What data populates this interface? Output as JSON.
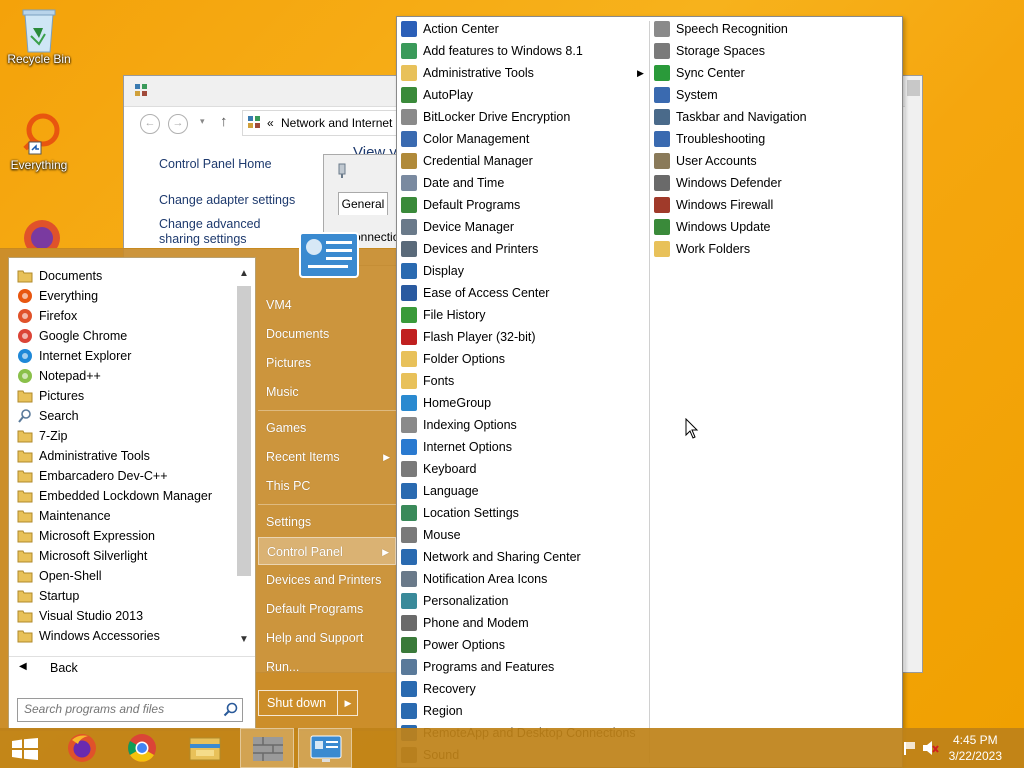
{
  "desktop": {
    "icons": [
      {
        "label": "Recycle Bin",
        "icon": "recycle-bin-icon"
      },
      {
        "label": "Everything",
        "icon": "everything-search-icon"
      }
    ]
  },
  "background_window": {
    "address_prefix": "«",
    "address_path": "Network and Internet",
    "sidebar_links": [
      "Control Panel Home",
      "Change adapter settings",
      "Change advanced sharing settings"
    ],
    "view_label": "View y",
    "dialog_tab": "General",
    "dialog_partial_text": "onnectio"
  },
  "start_menu": {
    "programs": [
      {
        "label": "Documents",
        "icon": "folder-icon"
      },
      {
        "label": "Everything",
        "icon": "everything-search-icon"
      },
      {
        "label": "Firefox",
        "icon": "firefox-icon"
      },
      {
        "label": "Google Chrome",
        "icon": "chrome-icon"
      },
      {
        "label": "Internet Explorer",
        "icon": "internet-explorer-icon"
      },
      {
        "label": "Notepad++",
        "icon": "notepad-plus-icon"
      },
      {
        "label": "Pictures",
        "icon": "folder-icon"
      },
      {
        "label": "Search",
        "icon": "search-icon"
      },
      {
        "label": "7-Zip",
        "icon": "folder-icon"
      },
      {
        "label": "Administrative Tools",
        "icon": "folder-icon"
      },
      {
        "label": "Embarcadero Dev-C++",
        "icon": "folder-icon"
      },
      {
        "label": "Embedded Lockdown Manager",
        "icon": "folder-icon"
      },
      {
        "label": "Maintenance",
        "icon": "folder-icon"
      },
      {
        "label": "Microsoft Expression",
        "icon": "folder-icon"
      },
      {
        "label": "Microsoft Silverlight",
        "icon": "folder-icon"
      },
      {
        "label": "Open-Shell",
        "icon": "folder-icon"
      },
      {
        "label": "Startup",
        "icon": "folder-icon"
      },
      {
        "label": "Visual Studio 2013",
        "icon": "folder-icon"
      },
      {
        "label": "Windows Accessories",
        "icon": "folder-icon"
      }
    ],
    "back_label": "Back",
    "search_placeholder": "Search programs and files",
    "right_items": {
      "user": "VM4",
      "documents": "Documents",
      "pictures": "Pictures",
      "music": "Music",
      "games": "Games",
      "recent_items": "Recent Items",
      "this_pc": "This PC",
      "settings": "Settings",
      "control_panel": "Control Panel",
      "devices_printers": "Devices and Printers",
      "default_programs": "Default Programs",
      "help_support": "Help and Support",
      "run": "Run..."
    },
    "shutdown_label": "Shut down"
  },
  "control_panel_menu": {
    "column1": [
      {
        "label": "Action Center",
        "color": "#2b5fb8"
      },
      {
        "label": "Add features to Windows 8.1",
        "color": "#3a9a5a"
      },
      {
        "label": "Administrative Tools",
        "color": "#e8c15a",
        "submenu": true
      },
      {
        "label": "AutoPlay",
        "color": "#3a8a3a"
      },
      {
        "label": "BitLocker Drive Encryption",
        "color": "#8a8a8a"
      },
      {
        "label": "Color Management",
        "color": "#3a6ab0"
      },
      {
        "label": "Credential Manager",
        "color": "#b08a3a"
      },
      {
        "label": "Date and Time",
        "color": "#7a8aa0"
      },
      {
        "label": "Default Programs",
        "color": "#3a8a3a"
      },
      {
        "label": "Device Manager",
        "color": "#6a7a8a"
      },
      {
        "label": "Devices and Printers",
        "color": "#5a6a7a"
      },
      {
        "label": "Display",
        "color": "#2a6ab0"
      },
      {
        "label": "Ease of Access Center",
        "color": "#2a5aa0"
      },
      {
        "label": "File History",
        "color": "#3a9a3a"
      },
      {
        "label": "Flash Player (32-bit)",
        "color": "#c02020"
      },
      {
        "label": "Folder Options",
        "color": "#e8c15a"
      },
      {
        "label": "Fonts",
        "color": "#e8c15a"
      },
      {
        "label": "HomeGroup",
        "color": "#2a8ad0"
      },
      {
        "label": "Indexing Options",
        "color": "#8a8a8a"
      },
      {
        "label": "Internet Options",
        "color": "#2a7ad0"
      },
      {
        "label": "Keyboard",
        "color": "#7a7a7a"
      },
      {
        "label": "Language",
        "color": "#2a6ab0"
      },
      {
        "label": "Location Settings",
        "color": "#3a8a5a"
      },
      {
        "label": "Mouse",
        "color": "#7a7a7a"
      },
      {
        "label": "Network and Sharing Center",
        "color": "#2a6ab0"
      },
      {
        "label": "Notification Area Icons",
        "color": "#6a7a8a"
      },
      {
        "label": "Personalization",
        "color": "#3a8a9a"
      },
      {
        "label": "Phone and Modem",
        "color": "#6a6a6a"
      },
      {
        "label": "Power Options",
        "color": "#3a7a3a"
      },
      {
        "label": "Programs and Features",
        "color": "#5a7a9a"
      },
      {
        "label": "Recovery",
        "color": "#2a6ab0"
      },
      {
        "label": "Region",
        "color": "#2a6ab0"
      },
      {
        "label": "RemoteApp and Desktop Connections",
        "color": "#2a6ab0"
      },
      {
        "label": "Sound",
        "color": "#6a6a6a"
      }
    ],
    "column2": [
      {
        "label": "Speech Recognition",
        "color": "#8a8a8a"
      },
      {
        "label": "Storage Spaces",
        "color": "#7a7a7a"
      },
      {
        "label": "Sync Center",
        "color": "#2a9a3a"
      },
      {
        "label": "System",
        "color": "#3a6ab0"
      },
      {
        "label": "Taskbar and Navigation",
        "color": "#4a6a8a"
      },
      {
        "label": "Troubleshooting",
        "color": "#3a6ab0"
      },
      {
        "label": "User Accounts",
        "color": "#8a7a5a"
      },
      {
        "label": "Windows Defender",
        "color": "#6a6a6a"
      },
      {
        "label": "Windows Firewall",
        "color": "#a03a2a"
      },
      {
        "label": "Windows Update",
        "color": "#3a8a3a"
      },
      {
        "label": "Work Folders",
        "color": "#e8c15a"
      }
    ]
  },
  "taskbar": {
    "items": [
      {
        "name": "start-button",
        "icon": "windows-logo-icon"
      },
      {
        "name": "firefox-taskbar-button",
        "icon": "firefox-icon"
      },
      {
        "name": "chrome-taskbar-button",
        "icon": "chrome-icon"
      },
      {
        "name": "file-explorer-taskbar-button",
        "icon": "file-explorer-icon"
      },
      {
        "name": "firewall-taskbar-button",
        "icon": "firewall-icon"
      },
      {
        "name": "control-panel-taskbar-button",
        "icon": "control-panel-icon"
      }
    ],
    "time": "4:45 PM",
    "date": "3/22/2023"
  }
}
